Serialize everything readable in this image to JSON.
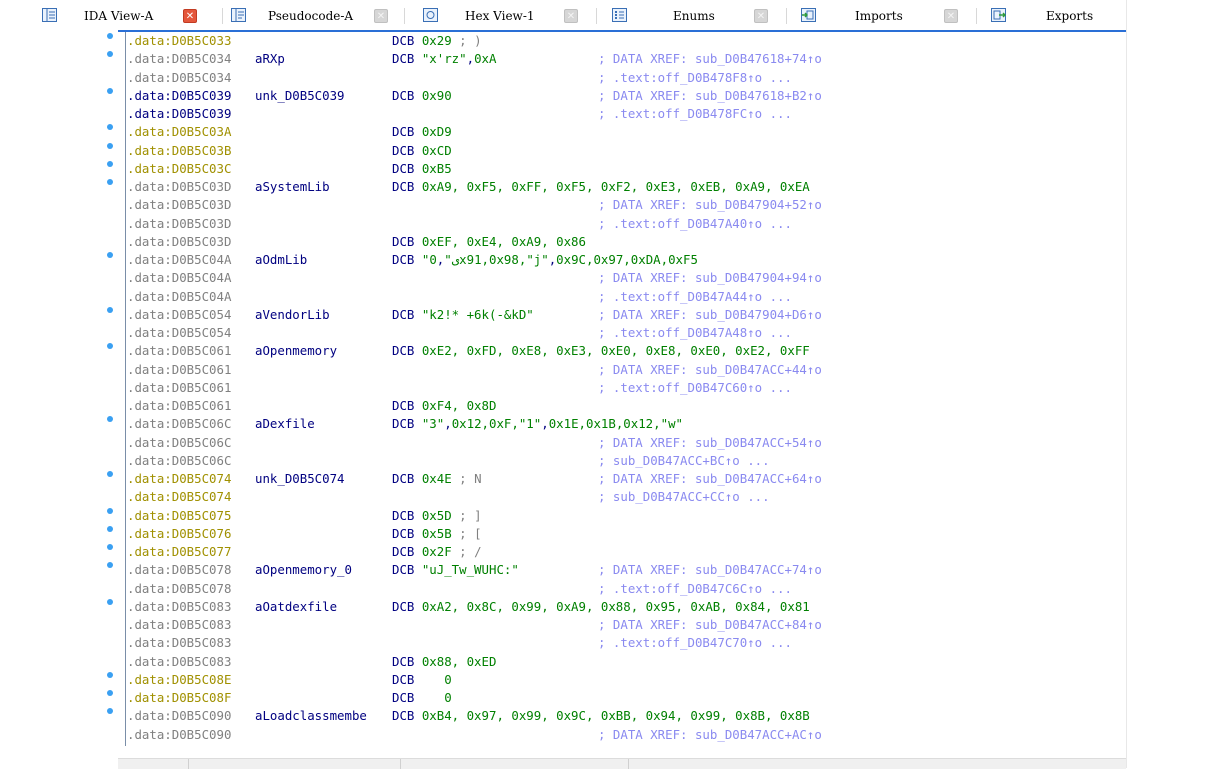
{
  "tabs": [
    {
      "label": "IDA View-A",
      "active": true,
      "icon": "listing-view-icon"
    },
    {
      "label": "Pseudocode-A",
      "active": false,
      "icon": "pseudocode-icon"
    },
    {
      "label": "Hex View-1",
      "active": false,
      "icon": "hex-view-icon"
    },
    {
      "label": "Enums",
      "active": false,
      "icon": "enums-icon"
    },
    {
      "label": "Imports",
      "active": false,
      "icon": "imports-icon"
    },
    {
      "label": "Exports",
      "active": false,
      "icon": "exports-icon"
    }
  ],
  "close_glyph": "✕",
  "colors": {
    "address_normal": "#808080",
    "address_highlight": "#a09000",
    "label": "#000080",
    "number": "#008000",
    "comment": "#8a8af0",
    "breakpoint_dot": "#3aa0f2",
    "active_tab_close": "#e4573c",
    "tab_underline": "#2a6fd6"
  },
  "lines": [
    {
      "addr": ".data:D0B5C033",
      "style": "hl",
      "dot": true,
      "label": "",
      "instr": [
        [
          "DCB ",
          "k"
        ],
        [
          "0x29",
          "n"
        ],
        [
          " ; )",
          "c"
        ]
      ],
      "comment": ""
    },
    {
      "addr": ".data:D0B5C034",
      "style": "normal",
      "dot": true,
      "label": "aRXp",
      "instr": [
        [
          "DCB ",
          "k"
        ],
        [
          "\"x'rz\"",
          "s"
        ],
        [
          ",",
          "k"
        ],
        [
          "0xA",
          "n"
        ]
      ],
      "comment": "; DATA XREF: sub_D0B47618+74↑o"
    },
    {
      "addr": ".data:D0B5C034",
      "style": "normal",
      "dot": false,
      "label": "",
      "instr": [],
      "comment": "; .text:off_D0B478F8↑o ..."
    },
    {
      "addr": ".data:D0B5C039",
      "style": "blue",
      "dot": true,
      "label": "unk_D0B5C039",
      "instr": [
        [
          "DCB ",
          "k"
        ],
        [
          "0x90",
          "n"
        ]
      ],
      "comment": "; DATA XREF: sub_D0B47618+B2↑o"
    },
    {
      "addr": ".data:D0B5C039",
      "style": "blue",
      "dot": false,
      "label": "",
      "instr": [],
      "comment": "; .text:off_D0B478FC↑o ..."
    },
    {
      "addr": ".data:D0B5C03A",
      "style": "hl",
      "dot": true,
      "label": "",
      "instr": [
        [
          "DCB ",
          "k"
        ],
        [
          "0xD9",
          "n"
        ]
      ],
      "comment": ""
    },
    {
      "addr": ".data:D0B5C03B",
      "style": "hl",
      "dot": true,
      "label": "",
      "instr": [
        [
          "DCB ",
          "k"
        ],
        [
          "0xCD",
          "n"
        ]
      ],
      "comment": ""
    },
    {
      "addr": ".data:D0B5C03C",
      "style": "hl",
      "dot": true,
      "label": "",
      "instr": [
        [
          "DCB ",
          "k"
        ],
        [
          "0xB5",
          "n"
        ]
      ],
      "comment": ""
    },
    {
      "addr": ".data:D0B5C03D",
      "style": "normal",
      "dot": true,
      "label": "aSystemLib",
      "instr": [
        [
          "DCB ",
          "k"
        ],
        [
          "0xA9, 0xF5, 0xFF, 0xF5, 0xF2, 0xE3, 0xEB, 0xA9, 0xEA",
          "n"
        ]
      ],
      "comment": ""
    },
    {
      "addr": ".data:D0B5C03D",
      "style": "normal",
      "dot": false,
      "label": "",
      "instr": [],
      "comment": "; DATA XREF: sub_D0B47904+52↑o"
    },
    {
      "addr": ".data:D0B5C03D",
      "style": "normal",
      "dot": false,
      "label": "",
      "instr": [],
      "comment": "; .text:off_D0B47A40↑o ..."
    },
    {
      "addr": ".data:D0B5C03D",
      "style": "normal",
      "dot": false,
      "label": "",
      "instr": [
        [
          "DCB ",
          "k"
        ],
        [
          "0xEF, 0xE4, 0xA9, 0x86",
          "n"
        ]
      ],
      "comment": ""
    },
    {
      "addr": ".data:D0B5C04A",
      "style": "normal",
      "dot": true,
      "label": "aOdmLib",
      "instr": [
        [
          "DCB ",
          "k"
        ],
        [
          "\"ى\"",
          "s"
        ],
        [
          ",",
          "k"
        ],
        [
          "0x91,0x98,",
          "n"
        ],
        [
          "\"j\"",
          "s"
        ],
        [
          ",",
          "k"
        ],
        [
          "0x9C,0x97,0xDA,0xF5",
          "n"
        ]
      ],
      "comment": ""
    },
    {
      "addr": ".data:D0B5C04A",
      "style": "normal",
      "dot": false,
      "label": "",
      "instr": [],
      "comment": "; DATA XREF: sub_D0B47904+94↑o"
    },
    {
      "addr": ".data:D0B5C04A",
      "style": "normal",
      "dot": false,
      "label": "",
      "instr": [],
      "comment": "; .text:off_D0B47A44↑o ..."
    },
    {
      "addr": ".data:D0B5C054",
      "style": "normal",
      "dot": true,
      "label": "aVendorLib",
      "instr": [
        [
          "DCB ",
          "k"
        ],
        [
          "\"k2!* +6k(-&kD\"",
          "s"
        ]
      ],
      "comment": "; DATA XREF: sub_D0B47904+D6↑o"
    },
    {
      "addr": ".data:D0B5C054",
      "style": "normal",
      "dot": false,
      "label": "",
      "instr": [],
      "comment": "; .text:off_D0B47A48↑o ..."
    },
    {
      "addr": ".data:D0B5C061",
      "style": "normal",
      "dot": true,
      "label": "aOpenmemory",
      "instr": [
        [
          "DCB ",
          "k"
        ],
        [
          "0xE2, 0xFD, 0xE8, 0xE3, 0xE0, 0xE8, 0xE0, 0xE2, 0xFF",
          "n"
        ]
      ],
      "comment": ""
    },
    {
      "addr": ".data:D0B5C061",
      "style": "normal",
      "dot": false,
      "label": "",
      "instr": [],
      "comment": "; DATA XREF: sub_D0B47ACC+44↑o"
    },
    {
      "addr": ".data:D0B5C061",
      "style": "normal",
      "dot": false,
      "label": "",
      "instr": [],
      "comment": "; .text:off_D0B47C60↑o ..."
    },
    {
      "addr": ".data:D0B5C061",
      "style": "normal",
      "dot": false,
      "label": "",
      "instr": [
        [
          "DCB ",
          "k"
        ],
        [
          "0xF4, 0x8D",
          "n"
        ]
      ],
      "comment": ""
    },
    {
      "addr": ".data:D0B5C06C",
      "style": "normal",
      "dot": true,
      "label": "aDexfile",
      "instr": [
        [
          "DCB ",
          "k"
        ],
        [
          "\"3\"",
          "s"
        ],
        [
          ",",
          "k"
        ],
        [
          "0x12,0xF,",
          "n"
        ],
        [
          "\"1\"",
          "s"
        ],
        [
          ",",
          "k"
        ],
        [
          "0x1E,0x1B,0x12,",
          "n"
        ],
        [
          "\"w\"",
          "s"
        ]
      ],
      "comment": ""
    },
    {
      "addr": ".data:D0B5C06C",
      "style": "normal",
      "dot": false,
      "label": "",
      "instr": [],
      "comment": "; DATA XREF: sub_D0B47ACC+54↑o"
    },
    {
      "addr": ".data:D0B5C06C",
      "style": "normal",
      "dot": false,
      "label": "",
      "instr": [],
      "comment": "; sub_D0B47ACC+BC↑o ..."
    },
    {
      "addr": ".data:D0B5C074",
      "style": "hl",
      "dot": true,
      "label": "unk_D0B5C074",
      "instr": [
        [
          "DCB ",
          "k"
        ],
        [
          "0x4E",
          "n"
        ],
        [
          " ; N",
          "c"
        ]
      ],
      "comment": "; DATA XREF: sub_D0B47ACC+64↑o"
    },
    {
      "addr": ".data:D0B5C074",
      "style": "hl",
      "dot": false,
      "label": "",
      "instr": [],
      "comment": "; sub_D0B47ACC+CC↑o ..."
    },
    {
      "addr": ".data:D0B5C075",
      "style": "hl",
      "dot": true,
      "label": "",
      "instr": [
        [
          "DCB ",
          "k"
        ],
        [
          "0x5D",
          "n"
        ],
        [
          " ; ]",
          "c"
        ]
      ],
      "comment": ""
    },
    {
      "addr": ".data:D0B5C076",
      "style": "hl",
      "dot": true,
      "label": "",
      "instr": [
        [
          "DCB ",
          "k"
        ],
        [
          "0x5B",
          "n"
        ],
        [
          " ; [",
          "c"
        ]
      ],
      "comment": ""
    },
    {
      "addr": ".data:D0B5C077",
      "style": "hl",
      "dot": true,
      "label": "",
      "instr": [
        [
          "DCB ",
          "k"
        ],
        [
          "0x2F",
          "n"
        ],
        [
          " ; /",
          "c"
        ]
      ],
      "comment": ""
    },
    {
      "addr": ".data:D0B5C078",
      "style": "normal",
      "dot": true,
      "label": "aOpenmemory_0",
      "instr": [
        [
          "DCB ",
          "k"
        ],
        [
          "\"uJ_Tw_WUHC:\"",
          "s"
        ]
      ],
      "comment": "; DATA XREF: sub_D0B47ACC+74↑o"
    },
    {
      "addr": ".data:D0B5C078",
      "style": "normal",
      "dot": false,
      "label": "",
      "instr": [],
      "comment": "; .text:off_D0B47C6C↑o ..."
    },
    {
      "addr": ".data:D0B5C083",
      "style": "normal",
      "dot": true,
      "label": "aOatdexfile",
      "instr": [
        [
          "DCB ",
          "k"
        ],
        [
          "0xA2, 0x8C, 0x99, 0xA9, 0x88, 0x95, 0xAB, 0x84, 0x81",
          "n"
        ]
      ],
      "comment": ""
    },
    {
      "addr": ".data:D0B5C083",
      "style": "normal",
      "dot": false,
      "label": "",
      "instr": [],
      "comment": "; DATA XREF: sub_D0B47ACC+84↑o"
    },
    {
      "addr": ".data:D0B5C083",
      "style": "normal",
      "dot": false,
      "label": "",
      "instr": [],
      "comment": "; .text:off_D0B47C70↑o ..."
    },
    {
      "addr": ".data:D0B5C083",
      "style": "normal",
      "dot": false,
      "label": "",
      "instr": [
        [
          "DCB ",
          "k"
        ],
        [
          "0x88, 0xED",
          "n"
        ]
      ],
      "comment": ""
    },
    {
      "addr": ".data:D0B5C08E",
      "style": "hl",
      "dot": true,
      "label": "",
      "instr": [
        [
          "DCB    ",
          "k"
        ],
        [
          "0",
          "n"
        ]
      ],
      "comment": ""
    },
    {
      "addr": ".data:D0B5C08F",
      "style": "hl",
      "dot": true,
      "label": "",
      "instr": [
        [
          "DCB    ",
          "k"
        ],
        [
          "0",
          "n"
        ]
      ],
      "comment": ""
    },
    {
      "addr": ".data:D0B5C090",
      "style": "normal",
      "dot": true,
      "label": "aLoadclassmembe",
      "instr": [
        [
          "DCB ",
          "k"
        ],
        [
          "0xB4, 0x97, 0x99, 0x9C, 0xBB, 0x94, 0x99, 0x8B, 0x8B",
          "n"
        ]
      ],
      "comment": ""
    },
    {
      "addr": ".data:D0B5C090",
      "style": "normal",
      "dot": false,
      "label": "",
      "instr": [],
      "comment": "; DATA XREF: sub_D0B47ACC+AC↑o"
    }
  ]
}
